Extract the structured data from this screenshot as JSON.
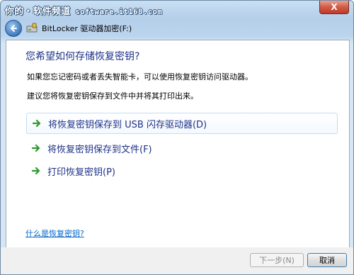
{
  "watermark": {
    "text_cn": "你的・软件频道",
    "text_url": " software.it168.com"
  },
  "titlebar": {
    "close_label": "X"
  },
  "nav": {
    "title": "BitLocker 驱动器加密(F:)"
  },
  "content": {
    "heading": "您希望如何存储恢复密钥?",
    "desc1": "如果您忘记密码或者丢失智能卡，可以使用恢复密钥访问驱动器。",
    "desc2": "建议您将恢复密钥保存到文件中并将其打印出来。",
    "options": [
      {
        "label": "将恢复密钥保存到 USB 闪存驱动器(D)"
      },
      {
        "label": "将恢复密钥保存到文件(F)"
      },
      {
        "label": "打印恢复密钥(P)"
      }
    ],
    "help_link": "什么是恢复密钥?"
  },
  "footer": {
    "next_label": "下一步(N)",
    "cancel_label": "取消"
  },
  "colors": {
    "heading": "#1e3287",
    "link": "#0066cc",
    "arrow_green": "#2e9a2e"
  }
}
